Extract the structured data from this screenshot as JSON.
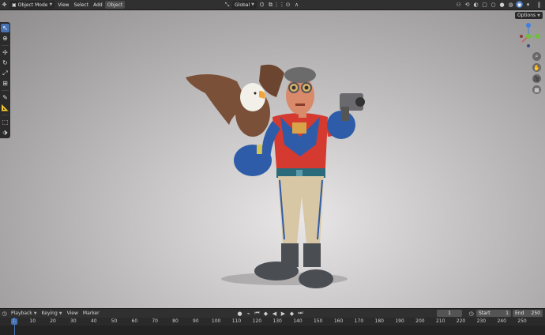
{
  "header": {
    "mode": "Object Mode",
    "menus": [
      "View",
      "Select",
      "Add",
      "Object"
    ],
    "active_menu": "Object",
    "transform_orientation": "Global"
  },
  "viewport": {
    "options_label": "Options"
  },
  "timeline": {
    "menus": [
      "Playback",
      "Keying",
      "View",
      "Marker"
    ],
    "current_frame": "1",
    "start_label": "Start",
    "start_value": "1",
    "end_label": "End",
    "end_value": "250",
    "ruler_ticks": [
      "10",
      "20",
      "30",
      "40",
      "50",
      "60",
      "70",
      "80",
      "90",
      "100",
      "110",
      "120",
      "130",
      "140",
      "150",
      "160",
      "170",
      "180",
      "190",
      "200",
      "210",
      "220",
      "230",
      "240",
      "250"
    ],
    "playhead_label": "1"
  },
  "colors": {
    "accent": "#4772b3",
    "axis_x": "#e0403f",
    "axis_y": "#6fbf3a",
    "axis_z": "#3f7fe0"
  }
}
